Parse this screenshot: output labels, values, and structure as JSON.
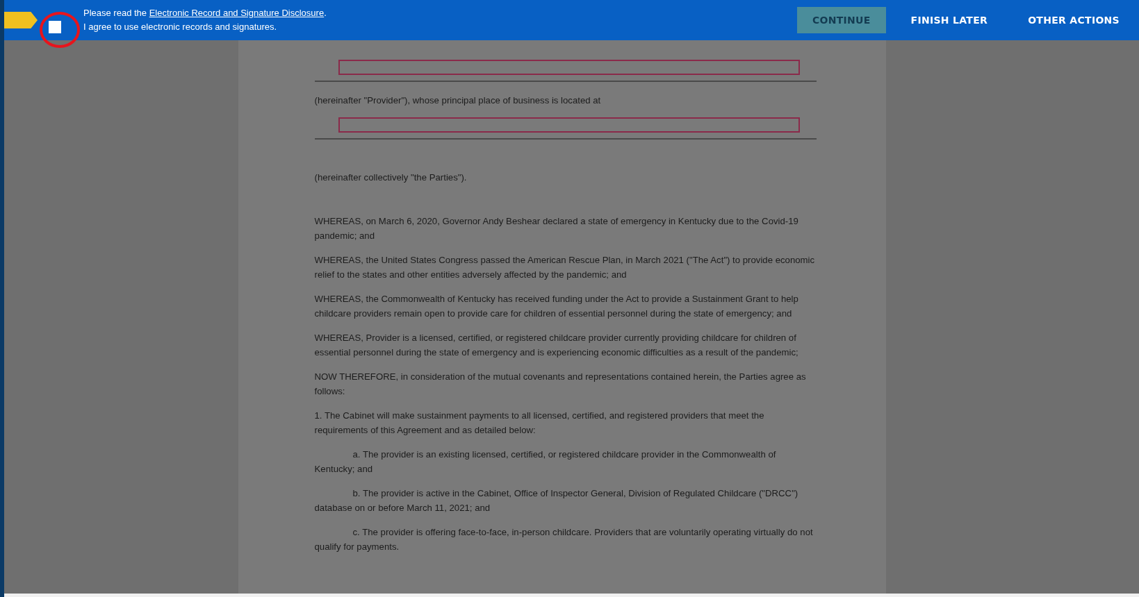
{
  "top_bar": {
    "notice_prefix": "Please read the ",
    "notice_link": "Electronic Record and Signature Disclosure",
    "notice_suffix": ".",
    "agree_label": "I agree to use electronic records and signatures.",
    "agree_checked": false,
    "buttons": [
      {
        "label": "CONTINUE",
        "kind": "primary",
        "disabled": true
      },
      {
        "label": "FINISH LATER",
        "kind": "plain",
        "disabled": false
      },
      {
        "label": "OTHER ACTIONS",
        "kind": "plain",
        "disabled": false
      }
    ]
  },
  "document": {
    "blocks": [
      {
        "kind": "field"
      },
      {
        "kind": "text",
        "text": "(hereinafter \"Provider\"), whose principal place of business is located at"
      },
      {
        "kind": "field"
      },
      {
        "kind": "spacer"
      },
      {
        "kind": "text",
        "text": "(hereinafter collectively \"the Parties\")."
      },
      {
        "kind": "spacer"
      },
      {
        "kind": "text",
        "text": "WHEREAS, on March 6, 2020, Governor Andy Beshear declared a state of emergency in Kentucky due to the Covid-19 pandemic; and"
      },
      {
        "kind": "text",
        "text": "WHEREAS, the United States Congress passed the American Rescue Plan, in March 2021 (\"The Act\") to provide economic relief to the states and other entities adversely affected by the pandemic; and"
      },
      {
        "kind": "text",
        "text": "WHEREAS, the Commonwealth of Kentucky has received funding under the Act to provide a Sustainment Grant to help childcare providers remain open to provide care for children of essential personnel during the state of emergency; and"
      },
      {
        "kind": "text",
        "text": "WHEREAS, Provider is a licensed, certified, or registered childcare provider currently providing childcare for children of essential personnel during the state of emergency and is experiencing economic difficulties as a result of the pandemic;"
      },
      {
        "kind": "text",
        "text": "NOW THEREFORE, in consideration of the mutual covenants and representations contained herein, the Parties agree as follows:"
      },
      {
        "kind": "text",
        "text": "1. The Cabinet will make sustainment payments to all licensed, certified, and registered providers that meet the requirements of this Agreement and as detailed below:"
      },
      {
        "kind": "indented",
        "text": "a. The provider is an existing licensed, certified, or registered childcare provider in the Commonwealth of Kentucky; and"
      },
      {
        "kind": "indented",
        "text": "b. The provider is active in the Cabinet, Office of Inspector General, Division of Regulated Childcare (\"DRCC\") database on or before March 11, 2021; and"
      },
      {
        "kind": "indented",
        "text": "c. The provider is offering face-to-face, in-person childcare. Providers that are voluntarily operating virtually do not qualify for payments."
      }
    ]
  }
}
